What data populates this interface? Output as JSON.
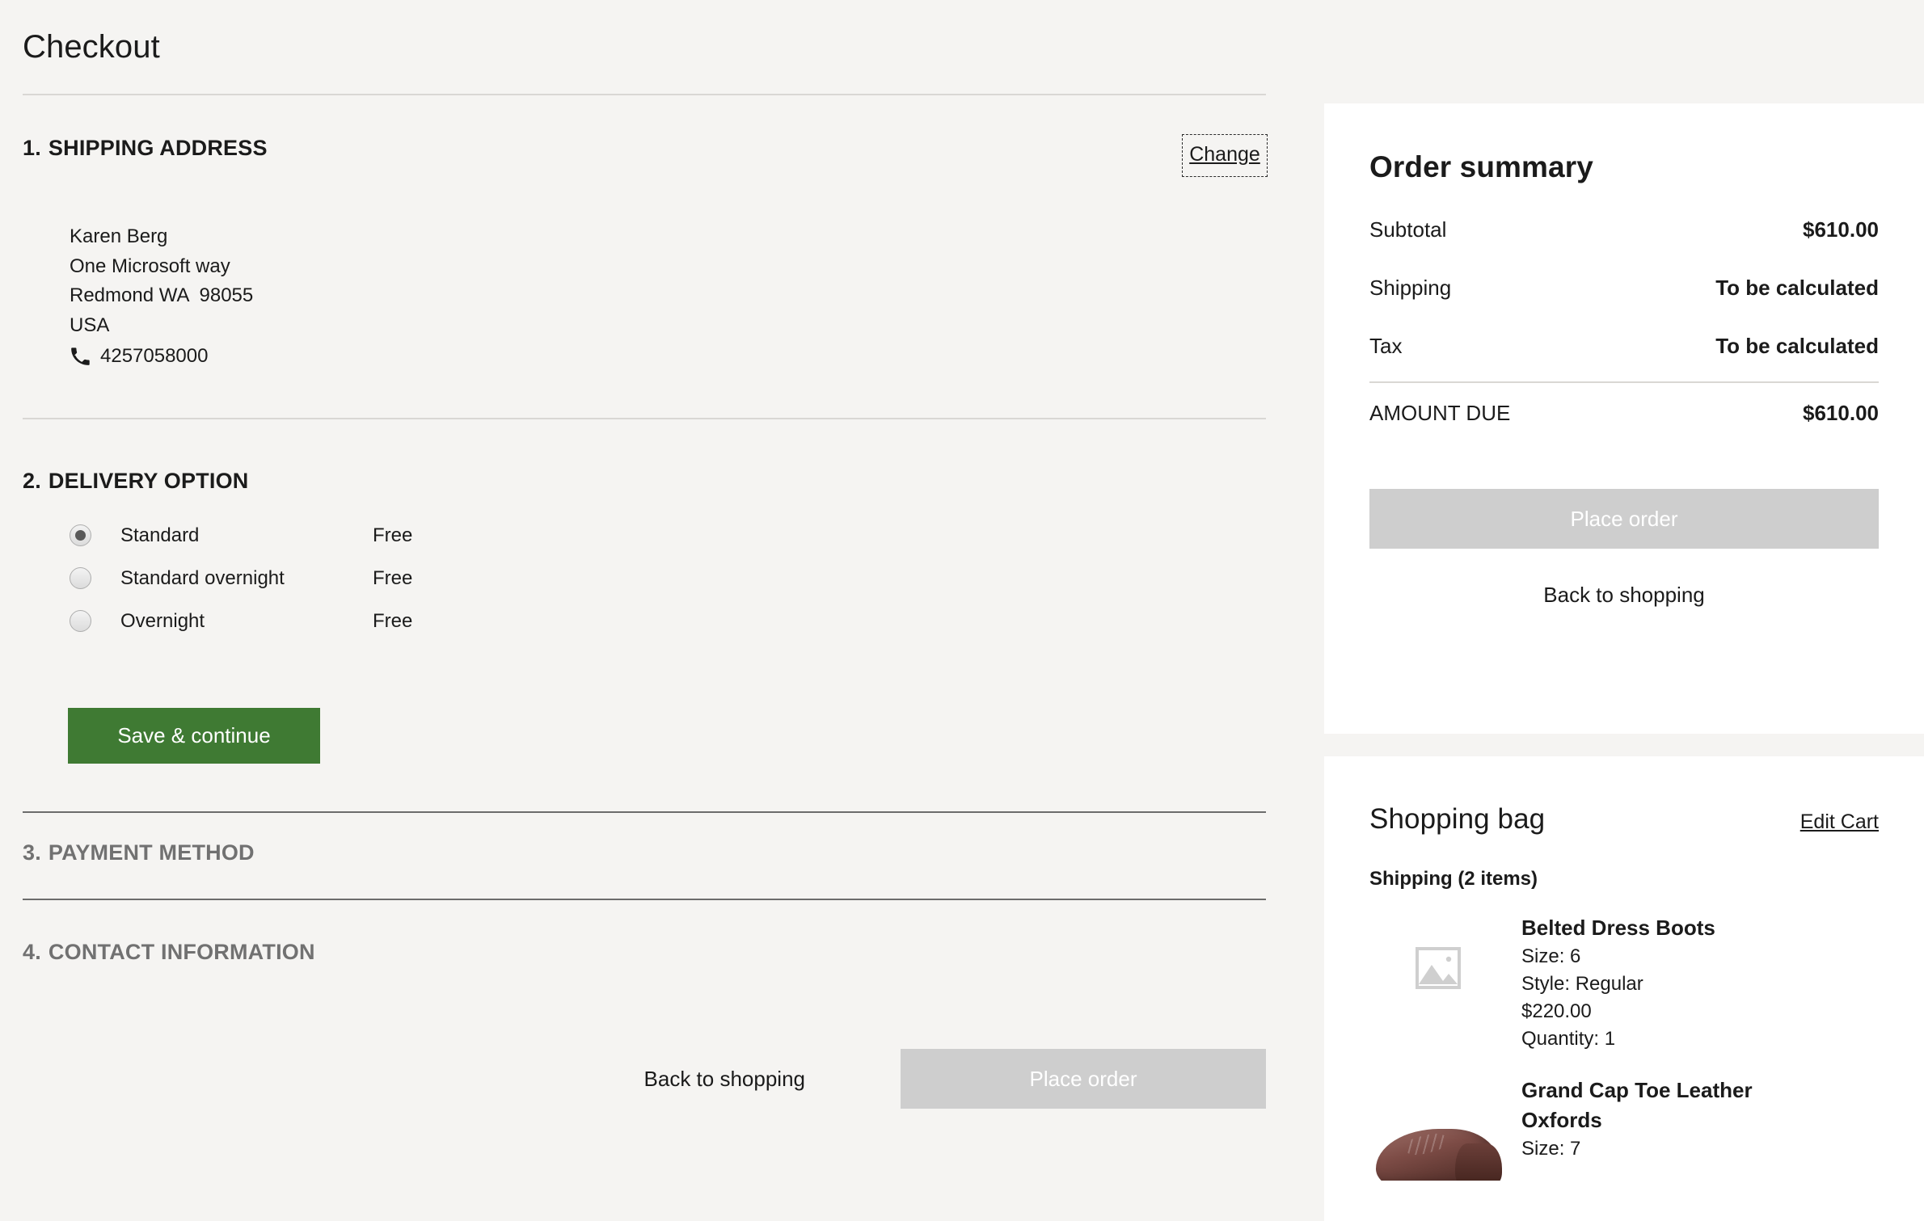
{
  "page": {
    "title": "Checkout"
  },
  "shipping_address": {
    "number": "1.",
    "heading": "SHIPPING ADDRESS",
    "change_label": "Change",
    "name": "Karen Berg",
    "street": "One Microsoft way",
    "city_state_zip": "Redmond WA  98055",
    "country": "USA",
    "phone": "4257058000",
    "phone_icon": "phone-icon"
  },
  "delivery_option": {
    "number": "2.",
    "heading": "DELIVERY OPTION",
    "options": [
      {
        "label": "Standard",
        "price": "Free",
        "selected": true
      },
      {
        "label": "Standard overnight",
        "price": "Free",
        "selected": false
      },
      {
        "label": "Overnight",
        "price": "Free",
        "selected": false
      }
    ],
    "save_label": "Save & continue"
  },
  "payment_method": {
    "number": "3.",
    "heading": "PAYMENT METHOD"
  },
  "contact_information": {
    "number": "4.",
    "heading": "CONTACT INFORMATION"
  },
  "bottom_actions": {
    "back_label": "Back to shopping",
    "place_order_label": "Place order"
  },
  "order_summary": {
    "title": "Order summary",
    "rows": [
      {
        "label": "Subtotal",
        "value": "$610.00"
      },
      {
        "label": "Shipping",
        "value": "To be calculated"
      },
      {
        "label": "Tax",
        "value": "To be calculated"
      }
    ],
    "total_label": "AMOUNT DUE",
    "total_value": "$610.00",
    "place_order_label": "Place order",
    "back_label": "Back to shopping"
  },
  "shopping_bag": {
    "title": "Shopping bag",
    "edit_label": "Edit Cart",
    "shipping_group": "Shipping (2 items)",
    "items": [
      {
        "name": "Belted Dress Boots",
        "size": "Size: 6",
        "style": "Style: Regular",
        "price": "$220.00",
        "quantity": "Quantity: 1",
        "image": "broken-image-placeholder-icon"
      },
      {
        "name": "Grand Cap Toe Leather Oxfords",
        "size": "Size: 7",
        "image": "oxford-shoe-photo"
      }
    ]
  },
  "colors": {
    "page_background": "#f5f4f2",
    "panel_background": "#ffffff",
    "primary_action": "#3f7a33",
    "disabled_action": "#cecece",
    "text": "#1b1b1b",
    "muted_text": "#717171",
    "divider": "#d9d7d4"
  }
}
